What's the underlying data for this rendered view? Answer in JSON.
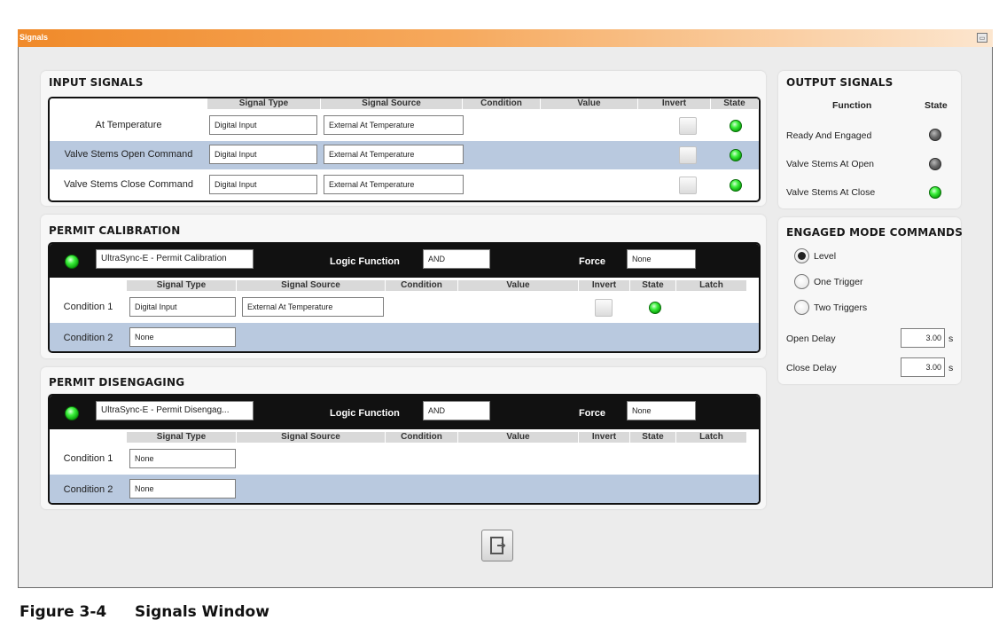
{
  "window": {
    "title": "Signals",
    "icon": "window-restore-icon"
  },
  "input_signals": {
    "title": "INPUT SIGNALS",
    "headers": [
      "Signal Type",
      "Signal Source",
      "Condition",
      "Value",
      "Invert",
      "State"
    ],
    "rows": [
      {
        "label": "At Temperature",
        "type": "Digital Input",
        "source": "External At Temperature",
        "state": "on"
      },
      {
        "label": "Valve Stems Open Command",
        "type": "Digital Input",
        "source": "External At Temperature",
        "state": "on"
      },
      {
        "label": "Valve Stems Close Command",
        "type": "Digital Input",
        "source": "External At Temperature",
        "state": "on"
      }
    ]
  },
  "output_signals": {
    "title": "OUTPUT SIGNALS",
    "function_header": "Function",
    "state_header": "State",
    "rows": [
      {
        "label": "Ready And Engaged",
        "state": "off"
      },
      {
        "label": "Valve Stems At Open",
        "state": "off"
      },
      {
        "label": "Valve Stems At Close",
        "state": "on"
      }
    ]
  },
  "permit_calibration": {
    "title": "PERMIT CALIBRATION",
    "name": "UltraSync-E - Permit Calibration",
    "logic_label": "Logic Function",
    "logic_value": "AND",
    "force_label": "Force",
    "force_value": "None",
    "headers": [
      "Signal Type",
      "Signal Source",
      "Condition",
      "Value",
      "Invert",
      "State",
      "Latch"
    ],
    "rows": [
      {
        "label": "Condition 1",
        "type": "Digital Input",
        "source": "External At Temperature"
      },
      {
        "label": "Condition 2",
        "type": "None"
      }
    ]
  },
  "permit_disengaging": {
    "title": "PERMIT DISENGAGING",
    "name": "UltraSync-E - Permit Disengag...",
    "logic_label": "Logic Function",
    "logic_value": "AND",
    "force_label": "Force",
    "force_value": "None",
    "headers": [
      "Signal Type",
      "Signal Source",
      "Condition",
      "Value",
      "Invert",
      "State",
      "Latch"
    ],
    "rows": [
      {
        "label": "Condition 1",
        "type": "None"
      },
      {
        "label": "Condition 2",
        "type": "None"
      }
    ]
  },
  "engaged_mode": {
    "title": "ENGAGED MODE COMMANDS",
    "options": [
      "Level",
      "One Trigger",
      "Two Triggers"
    ],
    "selected": "Level",
    "open_delay_label": "Open Delay",
    "open_delay_value": "3.00",
    "close_delay_label": "Close Delay",
    "close_delay_value": "3.00",
    "unit": "s"
  },
  "caption": {
    "number": "Figure 3-4",
    "text": "Signals Window"
  },
  "colors": {
    "titlebar": "#f08a2a",
    "row_alt": "#b9c9df",
    "led_on": "#3ef03e",
    "led_off": "#555555"
  }
}
